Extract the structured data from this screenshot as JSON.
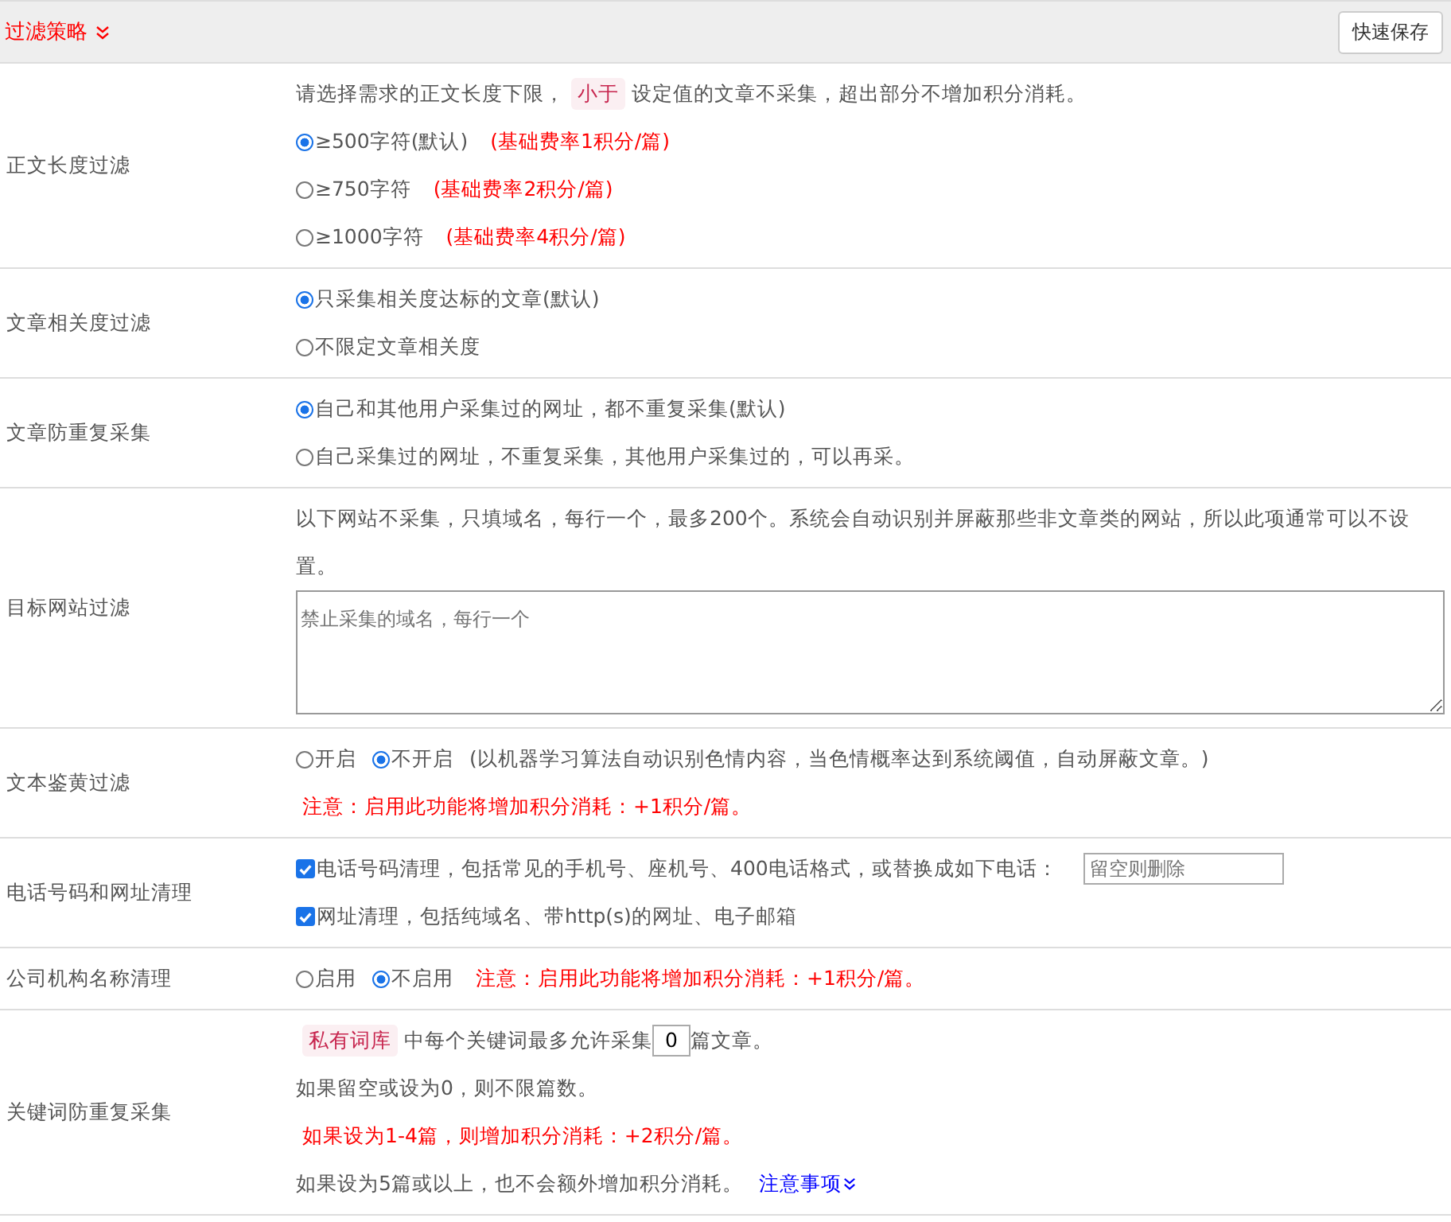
{
  "header": {
    "title": "过滤策略",
    "save_button": "快速保存"
  },
  "rows": [
    {
      "label": "正文长度过滤",
      "lines": [
        [
          {
            "kind": "text",
            "text": "请选择需求的正文长度下限，"
          },
          {
            "kind": "tag",
            "text": "小于"
          },
          {
            "kind": "text",
            "text": "设定值的文章不采集，超出部分不增加积分消耗。"
          }
        ],
        [
          {
            "kind": "radio",
            "text": "≥500字符(默认)",
            "selected": true
          },
          {
            "kind": "note",
            "text": "(基础费率1积分/篇)"
          }
        ],
        [
          {
            "kind": "radio",
            "text": "≥750字符",
            "selected": false
          },
          {
            "kind": "note",
            "text": "(基础费率2积分/篇)"
          }
        ],
        [
          {
            "kind": "radio",
            "text": "≥1000字符",
            "selected": false
          },
          {
            "kind": "note",
            "text": "(基础费率4积分/篇)"
          }
        ]
      ]
    },
    {
      "label": "文章相关度过滤",
      "lines": [
        [
          {
            "kind": "radio",
            "text": "只采集相关度达标的文章(默认)",
            "selected": true
          }
        ],
        [
          {
            "kind": "radio",
            "text": "不限定文章相关度",
            "selected": false
          }
        ]
      ]
    },
    {
      "label": "文章防重复采集",
      "lines": [
        [
          {
            "kind": "radio",
            "text": "自己和其他用户采集过的网址，都不重复采集(默认)",
            "selected": true
          }
        ],
        [
          {
            "kind": "radio",
            "text": "自己采集过的网址，不重复采集，其他用户采集过的，可以再采。",
            "selected": false
          }
        ]
      ]
    },
    {
      "label": "目标网站过滤",
      "lines": [
        [
          {
            "kind": "text",
            "text": "以下网站不采集，只填域名，每行一个，最多200个。系统会自动识别并屏蔽那些非文章类的网站，所以此项通常可以不设置。"
          }
        ],
        [
          {
            "kind": "textarea",
            "placeholder": "禁止采集的域名，每行一个"
          }
        ]
      ]
    },
    {
      "label": "文本鉴黄过滤",
      "lines": [
        [
          {
            "kind": "radio",
            "text": "开启",
            "selected": false
          },
          {
            "kind": "radio",
            "text": "不开启",
            "selected": true
          },
          {
            "kind": "text",
            "text": "(以机器学习算法自动识别色情内容，当色情概率达到系统阈值，自动屏蔽文章。)"
          }
        ],
        [
          {
            "kind": "note",
            "text": "注意：启用此功能将增加积分消耗：+1积分/篇。"
          }
        ]
      ]
    },
    {
      "label": "电话号码和网址清理",
      "lines": [
        [
          {
            "kind": "checkbox",
            "text": "电话号码清理，包括常见的手机号、座机号、400电话格式，或替换成如下电话：",
            "checked": true
          },
          {
            "kind": "input",
            "placeholder": "留空则删除"
          }
        ],
        [
          {
            "kind": "checkbox",
            "text": "网址清理，包括纯域名、带http(s)的网址、电子邮箱",
            "checked": true
          }
        ]
      ]
    },
    {
      "label": "公司机构名称清理",
      "lines": [
        [
          {
            "kind": "radio",
            "text": "启用",
            "selected": false
          },
          {
            "kind": "radio",
            "text": "不启用",
            "selected": true
          },
          {
            "kind": "note",
            "text": "注意：启用此功能将增加积分消耗：+1积分/篇。"
          }
        ]
      ]
    },
    {
      "label": "关键词防重复采集",
      "lines": [
        [
          {
            "kind": "tag",
            "text": "私有词库"
          },
          {
            "kind": "text",
            "text": "中每个关键词最多允许采集"
          },
          {
            "kind": "number",
            "value": "0"
          },
          {
            "kind": "text",
            "text": "篇文章。"
          }
        ],
        [
          {
            "kind": "text",
            "text": "如果留空或设为0，则不限篇数。"
          }
        ],
        [
          {
            "kind": "note",
            "text": "如果设为1-4篇，则增加积分消耗：+2积分/篇。"
          }
        ],
        [
          {
            "kind": "text",
            "text": "如果设为5篇或以上，也不会额外增加积分消耗。"
          },
          {
            "kind": "link",
            "text": "注意事项"
          }
        ]
      ]
    }
  ]
}
